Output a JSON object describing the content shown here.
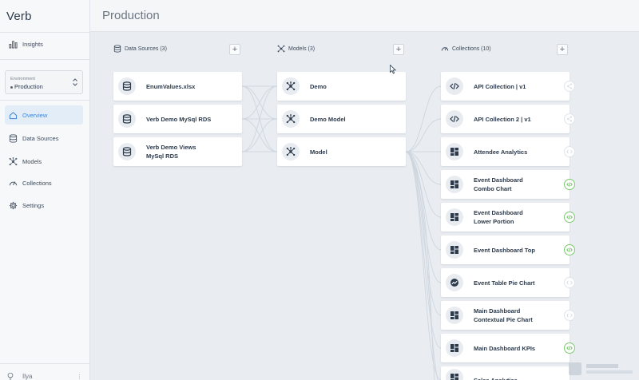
{
  "app": {
    "brand": "Verb"
  },
  "header": {
    "title": "Production"
  },
  "sidebar": {
    "insights": "Insights",
    "environment_label": "Environment",
    "environment_value": "Production",
    "nav": [
      {
        "label": "Overview",
        "icon": "home-icon"
      },
      {
        "label": "Data Sources",
        "icon": "database-icon"
      },
      {
        "label": "Models",
        "icon": "model-icon"
      },
      {
        "label": "Collections",
        "icon": "gauge-icon"
      },
      {
        "label": "Settings",
        "icon": "gear-icon"
      }
    ],
    "user_name": "Ilya"
  },
  "columns": {
    "data_sources": {
      "title": "Data Sources (3)"
    },
    "models": {
      "title": "Models (3)"
    },
    "collections": {
      "title": "Collections (10)"
    }
  },
  "data_sources": [
    {
      "name": "EnumValues.xlsx"
    },
    {
      "name": "Verb Demo MySql RDS"
    },
    {
      "name": "Verb Demo Views MySql RDS"
    }
  ],
  "models": [
    {
      "name": "Demo"
    },
    {
      "name": "Demo Model"
    },
    {
      "name": "Model"
    }
  ],
  "collections": [
    {
      "name": "API Collection | v1",
      "icon": "code-icon",
      "endpoint": "share"
    },
    {
      "name": "API Collection 2 | v1",
      "icon": "code-icon",
      "endpoint": "share"
    },
    {
      "name": "Attendee Analytics",
      "icon": "dashboard-icon",
      "endpoint": "grey"
    },
    {
      "name": "Event Dashboard Combo Chart",
      "icon": "dashboard-icon",
      "endpoint": "green"
    },
    {
      "name": "Event Dashboard Lower Portion",
      "icon": "dashboard-icon",
      "endpoint": "green"
    },
    {
      "name": "Event Dashboard Top",
      "icon": "dashboard-icon",
      "endpoint": "green"
    },
    {
      "name": "Event Table Pie Chart",
      "icon": "trend-icon",
      "endpoint": "grey"
    },
    {
      "name": "Main Dashboard Contextual Pie Chart",
      "icon": "dashboard-icon",
      "endpoint": "grey"
    },
    {
      "name": "Main Dashboard KPIs",
      "icon": "dashboard-icon",
      "endpoint": "green"
    },
    {
      "name": "Sales Analytics",
      "icon": "dashboard-icon",
      "endpoint": "grey"
    }
  ],
  "colors": {
    "accent": "#3f85d6",
    "endpoint_green": "#6cbf5e",
    "background": "#e9edf2"
  }
}
